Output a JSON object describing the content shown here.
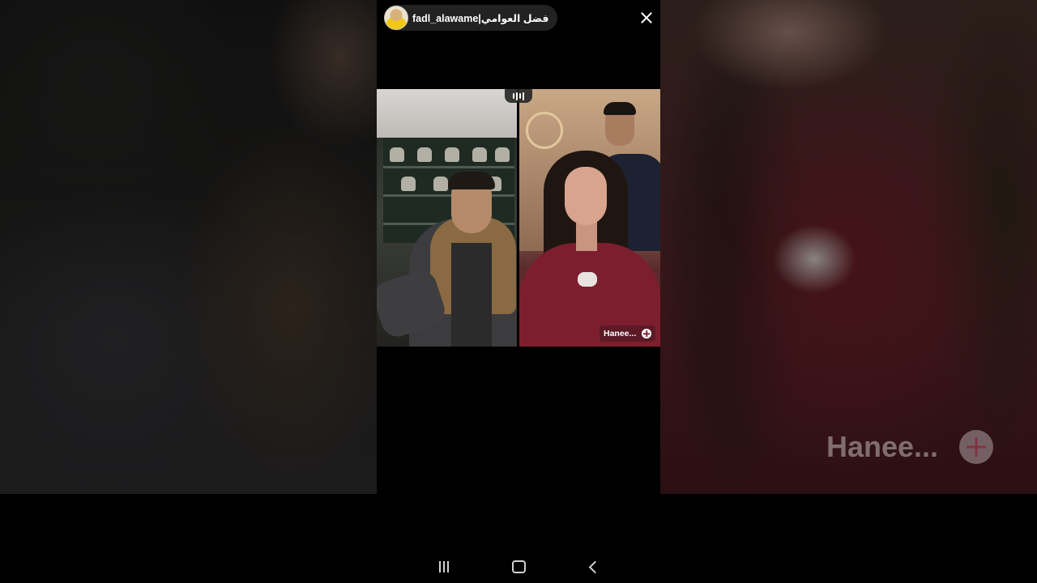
{
  "live": {
    "host_username": "fadl_alawame|فضل العوامي",
    "guest_username": "Hanee..."
  },
  "icons": {
    "close": "close-icon",
    "audio": "audio-bars-icon",
    "follow": "plus-circle-icon",
    "nav_recents": "recents-icon",
    "nav_home": "home-icon",
    "nav_back": "back-icon"
  },
  "colors": {
    "background": "#000000",
    "guest_accent": "#7d1e2f",
    "text": "#ffffff"
  }
}
